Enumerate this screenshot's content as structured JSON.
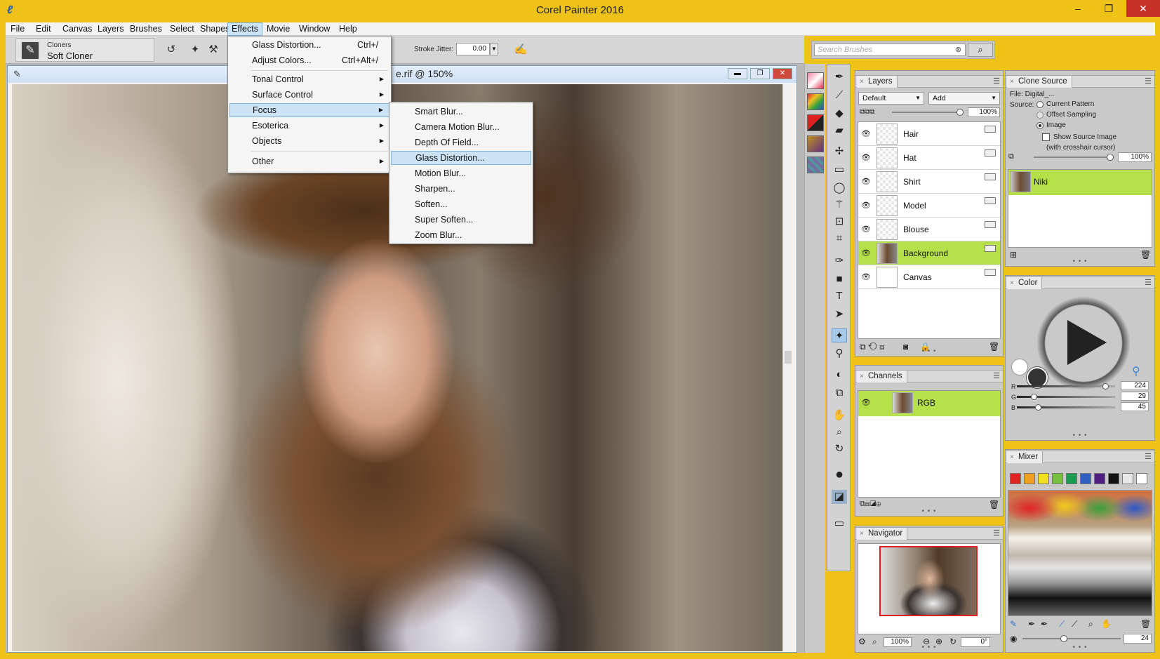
{
  "app": {
    "title": "Corel Painter 2016"
  },
  "menubar": [
    "File",
    "Edit",
    "Canvas",
    "Layers",
    "Brushes",
    "Select",
    "Shapes",
    "Effects",
    "Movie",
    "Window",
    "Help"
  ],
  "property_bar": {
    "brush_category": "Cloners",
    "brush_variant": "Soft Cloner",
    "stroke_jitter_label": "Stroke Jitter:",
    "stroke_jitter_value": "0.00"
  },
  "search": {
    "placeholder": "Search Brushes"
  },
  "document": {
    "title": "e.rif @ 150%"
  },
  "effects_menu": {
    "items": [
      {
        "label": "Glass Distortion...",
        "shortcut": "Ctrl+/"
      },
      {
        "label": "Adjust Colors...",
        "shortcut": "Ctrl+Alt+/"
      },
      {
        "label": "Tonal Control"
      },
      {
        "label": "Surface Control"
      },
      {
        "label": "Focus"
      },
      {
        "label": "Esoterica"
      },
      {
        "label": "Objects"
      },
      {
        "label": "Other"
      }
    ]
  },
  "focus_menu": {
    "items": [
      "Smart Blur...",
      "Camera Motion Blur...",
      "Depth Of Field...",
      "Glass Distortion...",
      "Motion Blur...",
      "Sharpen...",
      "Soften...",
      "Super Soften...",
      "Zoom Blur..."
    ],
    "highlighted_index": 3
  },
  "layers_panel": {
    "title": "Layers",
    "method": "Default",
    "composite": "Add",
    "opacity": "100%",
    "layers": [
      "Hair",
      "Hat",
      "Shirt",
      "Model",
      "Blouse",
      "Background",
      "Canvas"
    ],
    "selected_layer": "Background"
  },
  "channels_panel": {
    "title": "Channels",
    "channel": "RGB"
  },
  "navigator_panel": {
    "title": "Navigator",
    "zoom": "100%",
    "rotation": "0°"
  },
  "clone_source_panel": {
    "title": "Clone Source",
    "file": "File: Digital_...",
    "source_label": "Source:",
    "options": [
      "Current Pattern",
      "Offset Sampling",
      "Image"
    ],
    "selected_option": "Image",
    "show_source_label": "Show Source Image",
    "crosshair_note": "(with crosshair cursor)",
    "opacity": "100%",
    "source_item": "Niki"
  },
  "color_panel": {
    "title": "Color",
    "r": "224",
    "g": "29",
    "b": "45"
  },
  "mixer_panel": {
    "title": "Mixer",
    "swatches": [
      "#e02323",
      "#f0a020",
      "#f0e020",
      "#78c040",
      "#1e9a50",
      "#3060c0",
      "#502080",
      "#111111",
      "#e8e8e8",
      "#ffffff"
    ],
    "brush_size": "24"
  }
}
